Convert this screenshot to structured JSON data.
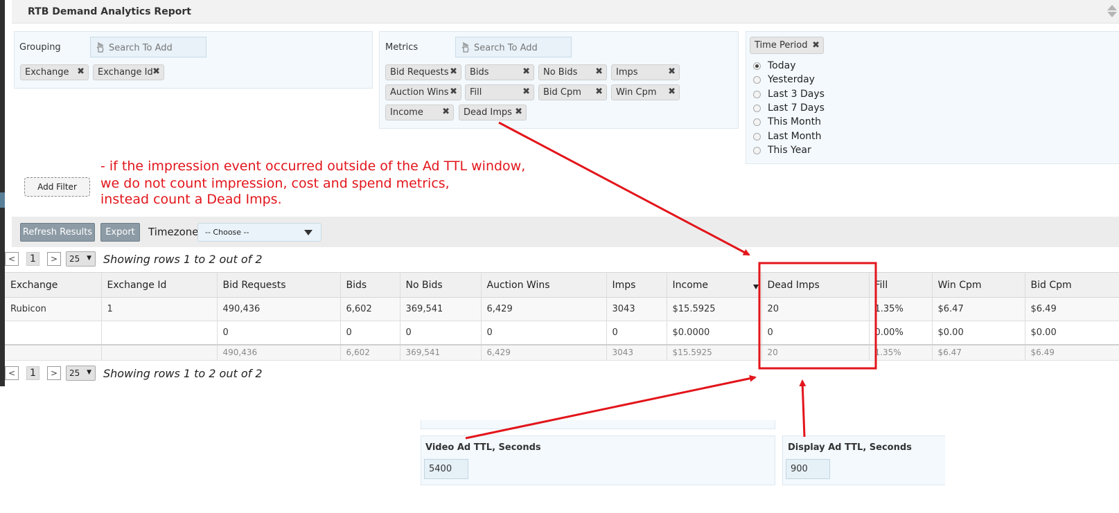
{
  "header": {
    "title": "RTB Demand Analytics Report"
  },
  "grouping": {
    "label": "Grouping",
    "search_placeholder": "Search To Add",
    "chips": [
      "Exchange",
      "Exchange Id"
    ]
  },
  "metrics": {
    "label": "Metrics",
    "search_placeholder": "Search To Add",
    "chips": [
      "Bid Requests",
      "Bids",
      "No Bids",
      "Imps",
      "Auction Wins",
      "Fill",
      "Bid Cpm",
      "Win Cpm",
      "Income",
      "Dead Imps"
    ]
  },
  "time_period": {
    "label": "Time Period",
    "options": [
      "Today",
      "Yesterday",
      "Last 3 Days",
      "Last 7 Days",
      "This Month",
      "Last Month",
      "This Year"
    ],
    "selected": "Today"
  },
  "filters": {
    "add_label": "Add Filter"
  },
  "annotation": {
    "lines": [
      "- if the impression event occurred outside of the Ad TTL window,",
      "we do not count impression, cost and spend metrics,",
      "instead count a Dead Imps."
    ],
    "color": "#e2151b"
  },
  "toolbar": {
    "refresh_label": "Refresh Results",
    "export_label": "Export",
    "timezone_label": "Timezone",
    "timezone_value": "-- Choose --"
  },
  "pager": {
    "prev": "<",
    "page": "1",
    "next": ">",
    "page_size": "25",
    "status": "Showing rows 1 to 2 out of 2"
  },
  "table": {
    "columns": [
      "Exchange",
      "Exchange Id",
      "Bid Requests",
      "Bids",
      "No Bids",
      "Auction Wins",
      "Imps",
      "Income",
      "Dead Imps",
      "Fill",
      "Win Cpm",
      "Bid Cpm"
    ],
    "rows": [
      [
        "Rubicon",
        "1",
        "490,436",
        "6,602",
        "369,541",
        "6,429",
        "3043",
        "$15.5925",
        "20",
        "1.35%",
        "$6.47",
        "$6.49"
      ],
      [
        "",
        "",
        "0",
        "0",
        "0",
        "0",
        "0",
        "$0.0000",
        "0",
        "0.00%",
        "$0.00",
        "$0.00"
      ]
    ],
    "totals": [
      "",
      "",
      "490,436",
      "6,602",
      "369,541",
      "6,429",
      "3043",
      "$15.5925",
      "20",
      "1.35%",
      "$6.47",
      "$6.49"
    ],
    "sorted_column": "Income"
  },
  "settings": {
    "video_ttl_label": "Video Ad TTL, Seconds",
    "video_ttl_value": "5400",
    "display_ttl_label": "Display Ad TTL, Seconds",
    "display_ttl_value": "900"
  },
  "colors": {
    "panel_bg": "#f3f9fd",
    "button_gray": "#8c9ba5",
    "highlight_red": "#e2151b"
  }
}
